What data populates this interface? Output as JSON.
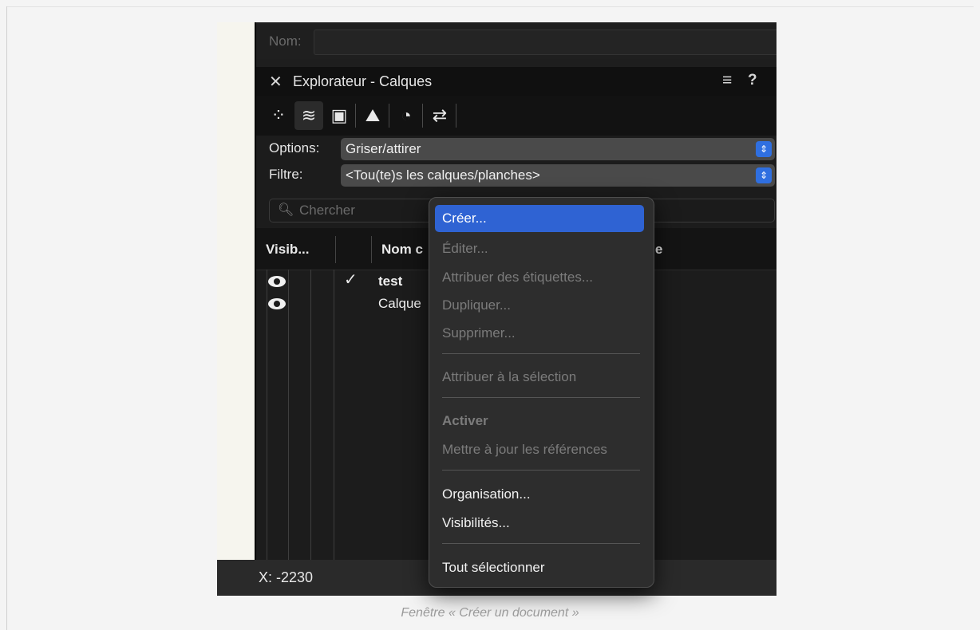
{
  "name_field": {
    "label": "Nom:",
    "value": ""
  },
  "panel": {
    "title": "Explorateur - Calques",
    "close_icon": "close-icon",
    "menu_icon": "hamburger-menu-icon",
    "help_label": "?"
  },
  "tabs": [
    {
      "icon": "network-icon",
      "glyph": "⁘",
      "active": false
    },
    {
      "icon": "layers-icon",
      "glyph": "≋",
      "active": true
    },
    {
      "icon": "sheet-icon",
      "glyph": "▣",
      "active": false
    },
    {
      "icon": "viewport-icon",
      "glyph": "⛰",
      "active": false
    },
    {
      "icon": "visibility-doc-icon",
      "glyph": "◔",
      "active": false
    },
    {
      "icon": "reference-icon",
      "glyph": "⇄",
      "active": false
    }
  ],
  "options": {
    "label": "Options:",
    "value": "Griser/attirer"
  },
  "filter": {
    "label": "Filtre:",
    "value": "<Tou(te)s les calques/planches>"
  },
  "search": {
    "placeholder": "Chercher"
  },
  "table": {
    "columns": [
      "Visib...",
      "Nom c",
      "age"
    ],
    "rows": [
      {
        "name": "test",
        "active": true,
        "visible": true
      },
      {
        "name": "Calque",
        "active": false,
        "visible": true
      }
    ]
  },
  "status": {
    "coord": "X:  -2230"
  },
  "context_menu": {
    "items": [
      {
        "label": "Créer...",
        "enabled": true,
        "highlighted": true
      },
      {
        "label": "Éditer...",
        "enabled": false
      },
      {
        "label": "Attribuer des étiquettes...",
        "enabled": false
      },
      {
        "label": "Dupliquer...",
        "enabled": false
      },
      {
        "label": "Supprimer...",
        "enabled": false
      },
      {
        "label": "Attribuer à la sélection",
        "enabled": false
      },
      {
        "label": "Activer",
        "enabled": false,
        "bold": true
      },
      {
        "label": "Mettre à jour les références",
        "enabled": false
      },
      {
        "label": "Organisation...",
        "enabled": true
      },
      {
        "label": "Visibilités...",
        "enabled": true
      },
      {
        "label": "Tout sélectionner",
        "enabled": true
      }
    ]
  },
  "caption": "Fenêtre « Créer un document »",
  "colors": {
    "highlight": "#2f63d3",
    "popup_arrow": "#2f6fe0",
    "panel_bg": "#1c1c1c"
  }
}
